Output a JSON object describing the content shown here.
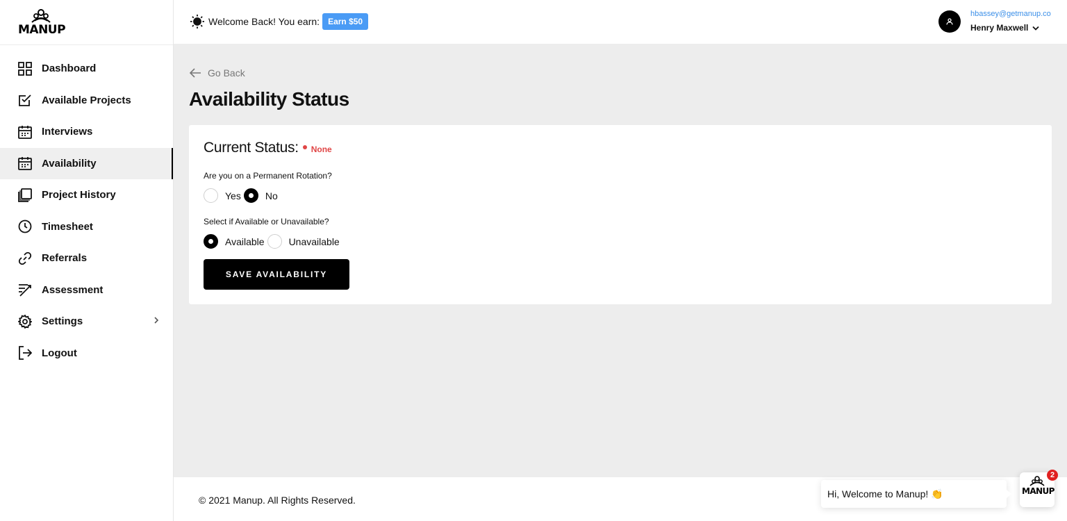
{
  "brand": {
    "name": "MANUP"
  },
  "sidebar": {
    "items": [
      {
        "label": "Dashboard",
        "icon": "grid-icon"
      },
      {
        "label": "Available Projects",
        "icon": "checkbox-icon"
      },
      {
        "label": "Interviews",
        "icon": "calendar-icon"
      },
      {
        "label": "Availability",
        "icon": "calendar-icon",
        "active": true
      },
      {
        "label": "Project History",
        "icon": "stacked-folders-icon"
      },
      {
        "label": "Timesheet",
        "icon": "clock-icon"
      },
      {
        "label": "Referrals",
        "icon": "link-icon"
      },
      {
        "label": "Assessment",
        "icon": "checklist-icon"
      },
      {
        "label": "Settings",
        "icon": "gear-icon",
        "has_submenu": true
      },
      {
        "label": "Logout",
        "icon": "logout-icon"
      }
    ]
  },
  "header": {
    "welcome_text": "Welcome Back! You earn:",
    "earn_badge": "Earn $50",
    "user": {
      "email": "hbassey@getmanup.co",
      "name": "Henry Maxwell"
    }
  },
  "main": {
    "go_back": "Go Back",
    "title": "Availability Status",
    "card": {
      "status_label": "Current Status:",
      "status_value": "None",
      "status_color": "#e04646",
      "rotation_question": "Are you on a Permanent Rotation?",
      "rotation_options": [
        "Yes",
        "No"
      ],
      "rotation_selected": "No",
      "availability_question": "Select if Available or Unavailable?",
      "availability_options": [
        "Available",
        "Unavailable"
      ],
      "availability_selected": "Available",
      "save_button": "SAVE AVAILABILITY"
    }
  },
  "footer": {
    "copyright": "© 2021 Manup. All Rights Reserved."
  },
  "chat": {
    "message": "Hi, Welcome to Manup! 👏",
    "unread_count": "2",
    "launcher_text": "MANUP"
  },
  "colors": {
    "accent": "#4a9bf5",
    "primary": "#000000",
    "danger": "#e04646"
  }
}
